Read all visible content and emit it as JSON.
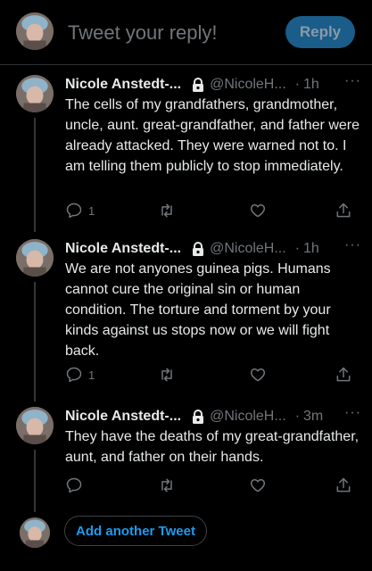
{
  "reply": {
    "placeholder": "Tweet your reply!",
    "button_label": "Reply"
  },
  "tweets": [
    {
      "name": "Nicole Anstedt-...",
      "handle": "@NicoleH...",
      "dot": "·",
      "time": "1h",
      "more": "···",
      "body": "The cells of my grandfathers, grandmother, uncle, aunt. great-grandfather, and father were already attacked. They were warned not to. I am telling them publicly to stop immediately.",
      "reply_count": "1"
    },
    {
      "name": "Nicole Anstedt-...",
      "handle": "@NicoleH...",
      "dot": "·",
      "time": "1h",
      "more": "···",
      "body": "We are not anyones guinea pigs. Humans cannot cure the original sin or human condition. The torture and torment by your kinds against us stops now or we will fight back.",
      "reply_count": "1"
    },
    {
      "name": "Nicole Anstedt-...",
      "handle": "@NicoleH...",
      "dot": "·",
      "time": "3m",
      "more": "···",
      "body": "They have the deaths of my great-grandfather, aunt, and father on their hands.",
      "reply_count": ""
    }
  ],
  "add_tweet": {
    "label": "Add another Tweet"
  },
  "icons": {
    "reply": "reply-icon",
    "retweet": "retweet-icon",
    "like": "like-icon",
    "share": "share-icon",
    "lock": "lock-icon"
  },
  "colors": {
    "accent": "#1d9bf0",
    "muted": "#71767b",
    "text": "#e7e9ea",
    "background": "#000000"
  }
}
